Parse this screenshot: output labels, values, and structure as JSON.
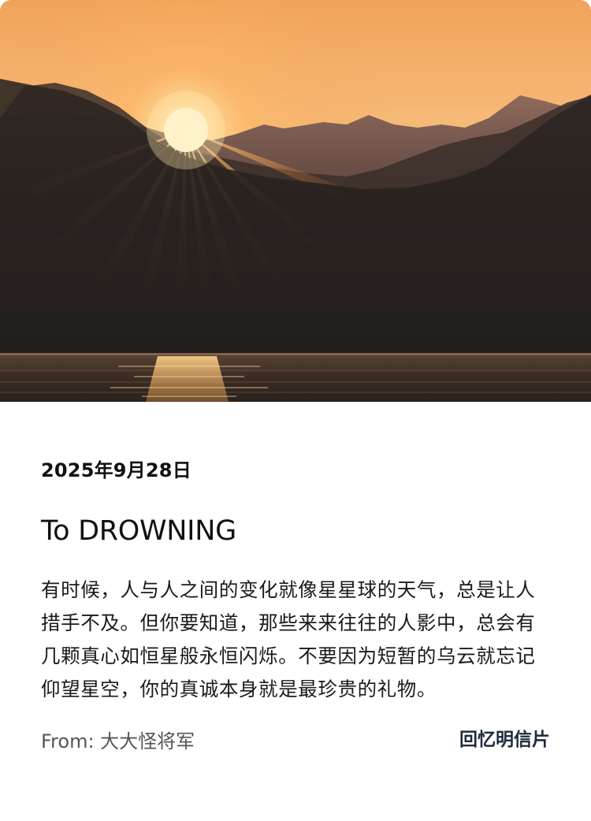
{
  "postcard": {
    "date": "2025年9月28日",
    "title": "To DROWNING",
    "message": "有时候，人与人之间的变化就像星星球的天气，总是让人措手不及。但你要知道，那些来来往往的人影中，总会有几颗真心如恒星般永恒闪烁。不要因为短暂的乌云就忘记仰望星空，你的真诚本身就是最珍贵的礼物。",
    "from": "From: 大大怪将军",
    "memory_link": "回忆明信片"
  },
  "colors": {
    "sky_top": "#f2a65a",
    "sky_glow": "#ffd79a",
    "sun": "#fff6d8",
    "mountain_far": "#6b4a3c",
    "mountain_near": "#23201e",
    "water": "#3a2a22",
    "link": "#1e2a3c"
  }
}
